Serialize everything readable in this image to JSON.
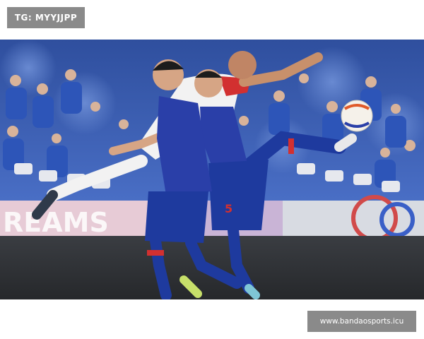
{
  "header": {
    "tag_label": "TG: MYYJJPP"
  },
  "photo": {
    "subject": "Two footballers in blue kits challenging an opponent in red and white for the ball mid-air in front of a crowd",
    "shirt_number": "5",
    "banner_text": "REAMS",
    "colors": {
      "home_kit": "#2a3fa8",
      "home_shorts": "#1e3a9e",
      "away_kit": "#f2f2f2",
      "away_accent": "#d23030",
      "pitch_board": "#2f3236",
      "crowd": "#3f66c2"
    }
  },
  "footer": {
    "watermark_text": "www.bandaosports.icu"
  }
}
